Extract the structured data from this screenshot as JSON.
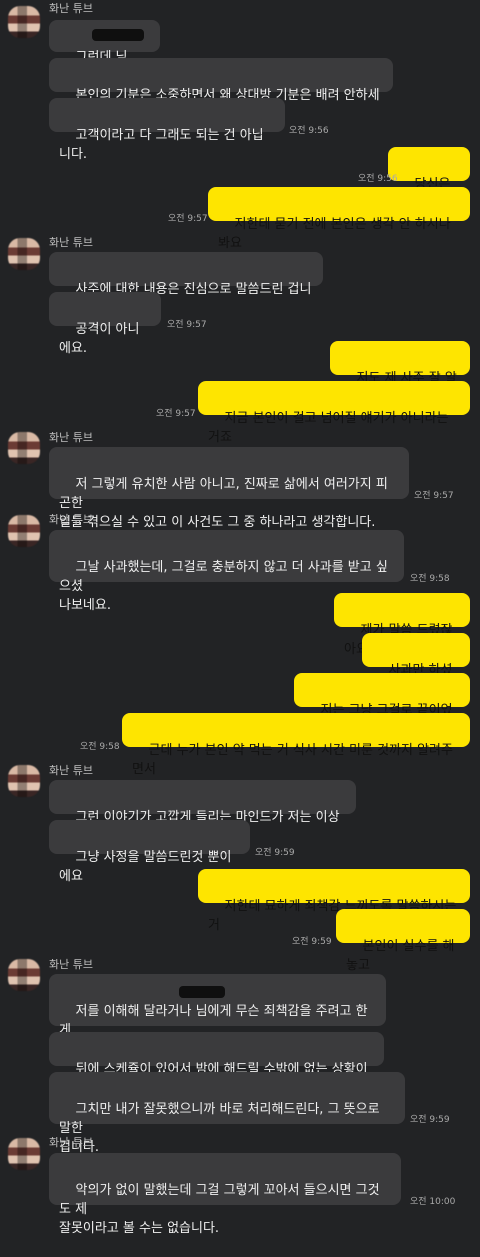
{
  "chat": {
    "messages": [
      {
        "text": "그런데 님",
        "type": "incoming"
      },
      {
        "text": "본인의 기분은 소중하면서 왜 상대방 기분은 배려 안하세요?",
        "type": "incoming"
      },
      {
        "text": "고객이라고 다 그래도 되는 건 아닙니다.",
        "type": "incoming",
        "time": "오전 9:56"
      },
      {
        "text": "당신은요?",
        "type": "outgoing",
        "time": "오전 9:56"
      },
      {
        "text": "저한테 묻기 전에 본인은 생각 안 하시나봐요",
        "type": "outgoing",
        "time": "오전 9:57"
      },
      {
        "text": "사주에 대한 내용은 진심으로 말씀드린 겁니다.",
        "type": "incoming"
      },
      {
        "text": "공격이 아니에요.",
        "type": "incoming",
        "time": "오전 9:57"
      },
      {
        "text": "저도 제 사주 잘 알아요",
        "type": "outgoing"
      },
      {
        "text": "지금 본인이 걸고 넘어질 얘기가 아니라는 거죠",
        "type": "outgoing",
        "time": "오전 9:57"
      },
      {
        "text": "저 그렇게 유치한 사람 아니고, 진짜로 삶에서 여러가지 피곤한\n일들 겪으실 수 있고 이 사건도 그 중 하나라고 생각합니다.",
        "type": "incoming",
        "time": "오전 9:57"
      },
      {
        "text": "그날 사과했는데, 그걸로 충분하지 않고 더 사과를 받고 싶으셨\n나보네요.",
        "type": "incoming",
        "time": "오전 9:58"
      },
      {
        "text": "제가 말씀 드렸잖아요",
        "type": "outgoing"
      },
      {
        "text": "사과만 하셨으면",
        "type": "outgoing"
      },
      {
        "text": "저는 그냥 그걸로 끝이었다고",
        "type": "outgoing"
      },
      {
        "text": "근데 누가 본인 약 먹는 거 식사 시간 미룬 것까지 알려주면서",
        "type": "outgoing",
        "time": "오전 9:58"
      },
      {
        "text": "그런 이야기가 고깝게 들리는 마인드가 저는 이상해요",
        "type": "incoming"
      },
      {
        "text": "그냥 사정을 말씀드린것 뿐이에요",
        "type": "incoming",
        "time": "오전 9:59"
      },
      {
        "text": "저한테 묘하게 죄책감 느끼도록 말씀하시는 거",
        "type": "outgoing"
      },
      {
        "text": "본인이 실수를 해놓고",
        "type": "outgoing",
        "time": "오전 9:59"
      },
      {
        "text": "저를 이해해 달라거나 님에게 무슨 죄책감을 주려고 한게\n아니라",
        "type": "incoming"
      },
      {
        "text": "뒤에 스케쥴이 있어서 밤에 해드릴 수밖에 없는 상황이었고",
        "type": "incoming"
      },
      {
        "text": "그치만 내가 잘못했으니까 바로 처리해드린다, 그 뜻으로 말한\n겁니다.",
        "type": "incoming",
        "time": "오전 9:59"
      },
      {
        "text": "악의가 없이 말했는데 그걸 그렇게 꼬아서 들으시면 그것도 제\n잘못이라고 볼 수는 없습니다.",
        "type": "incoming",
        "time": "오전 10:00"
      }
    ],
    "sender_name": "화난 튜브"
  }
}
